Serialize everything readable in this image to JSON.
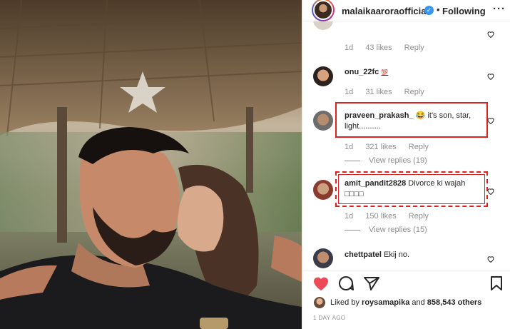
{
  "header": {
    "username": "malaikaaroraofficial",
    "verified_glyph": "✓",
    "separator": "•",
    "follow_status": "Following",
    "more_glyph": "···"
  },
  "comments": [
    {
      "id": "c0",
      "username": "",
      "text": "",
      "time": "1d",
      "likes": "43 likes",
      "reply": "Reply"
    },
    {
      "id": "c1",
      "username": "onu_22fc",
      "text": "💯",
      "time": "1d",
      "likes": "31 likes",
      "reply": "Reply"
    },
    {
      "id": "c2",
      "username": "praveen_prakash_",
      "text": "😂 it's son, star, light..........",
      "time": "1d",
      "likes": "321 likes",
      "reply": "Reply",
      "view_replies": "View replies (19)",
      "highlighted": true
    },
    {
      "id": "c3",
      "username": "amit_pandit2828",
      "text": "Divorce ki wajah □□□□",
      "time": "1d",
      "likes": "150 likes",
      "reply": "Reply",
      "view_replies": "View replies (15)",
      "highlighted": true
    },
    {
      "id": "c4",
      "username": "chettpatel",
      "text": "Ekij no."
    }
  ],
  "actions": {
    "icons": [
      "heart-filled-icon",
      "comment-icon",
      "share-icon",
      "bookmark-icon"
    ],
    "like_color": "#ed4956"
  },
  "likes": {
    "prefix": "Liked by",
    "user": "roysamapika",
    "conj": "and",
    "count": "858,543 others"
  },
  "post_date": "1 DAY AGO",
  "colors": {
    "highlight": "#e0211f",
    "verified": "#3897f0",
    "meta": "#8e8e8e"
  }
}
